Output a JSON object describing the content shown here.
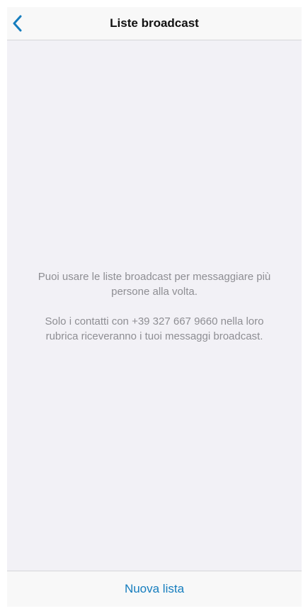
{
  "navbar": {
    "title": "Liste broadcast",
    "back_icon": "chevron-left-icon"
  },
  "content": {
    "paragraph_1": "Puoi usare le liste broadcast per messaggiare più persone alla volta.",
    "paragraph_2": "Solo i contatti con +39 327 667 9660 nella loro rubrica riceveranno i tuoi messaggi broadcast."
  },
  "bottom_bar": {
    "new_list_label": "Nuova lista"
  },
  "colors": {
    "accent": "#157dbe",
    "background": "#f2f1f6",
    "secondary_text": "#8e8e93"
  }
}
